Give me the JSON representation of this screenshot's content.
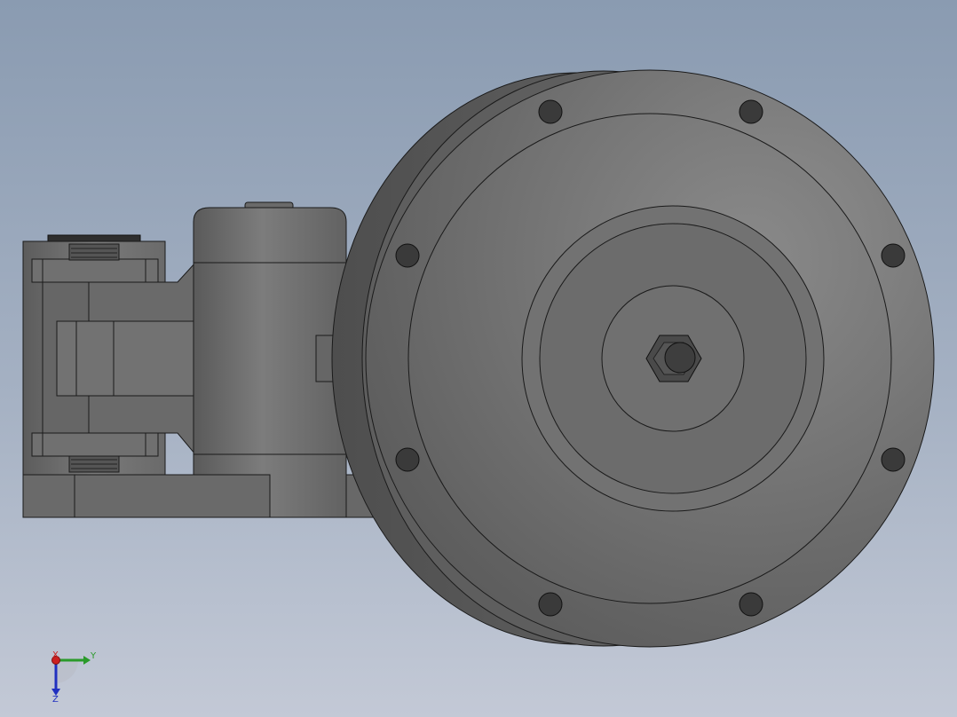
{
  "triad": {
    "x_label": "X",
    "y_label": "Y",
    "z_label": "Z",
    "x_color": "#cc2020",
    "y_color": "#2a9a2a",
    "z_color": "#2030c0"
  },
  "model": {
    "body_color": "#6e6e6e",
    "edge_color": "#1a1a1a",
    "bolt_color": "#3a3a3a",
    "bolt_count": 8
  }
}
